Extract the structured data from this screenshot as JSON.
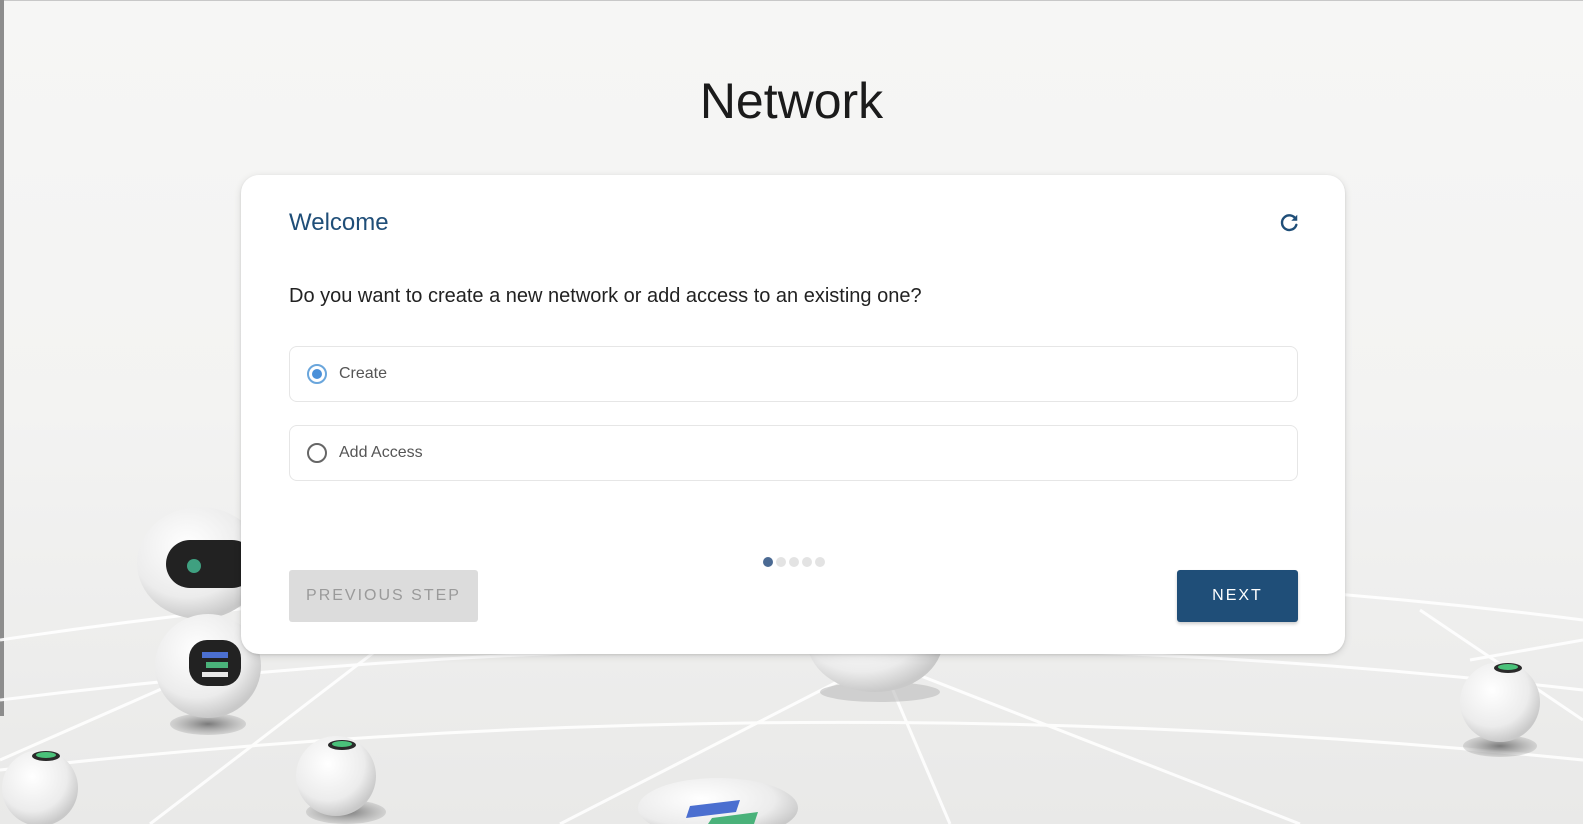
{
  "page": {
    "title": "Network"
  },
  "card": {
    "title": "Welcome",
    "refresh_icon": "refresh-icon",
    "question": "Do you want to create a new network or add access to an existing one?",
    "options": [
      {
        "label": "Create",
        "selected": true
      },
      {
        "label": "Add Access",
        "selected": false
      }
    ],
    "stepper": {
      "total": 5,
      "current": 1
    },
    "prev_label": "PREVIOUS STEP",
    "next_label": "NEXT"
  },
  "colors": {
    "accent": "#1f4e78",
    "radio_selected": "#4a90d9",
    "button_disabled": "#dcdcdc"
  }
}
